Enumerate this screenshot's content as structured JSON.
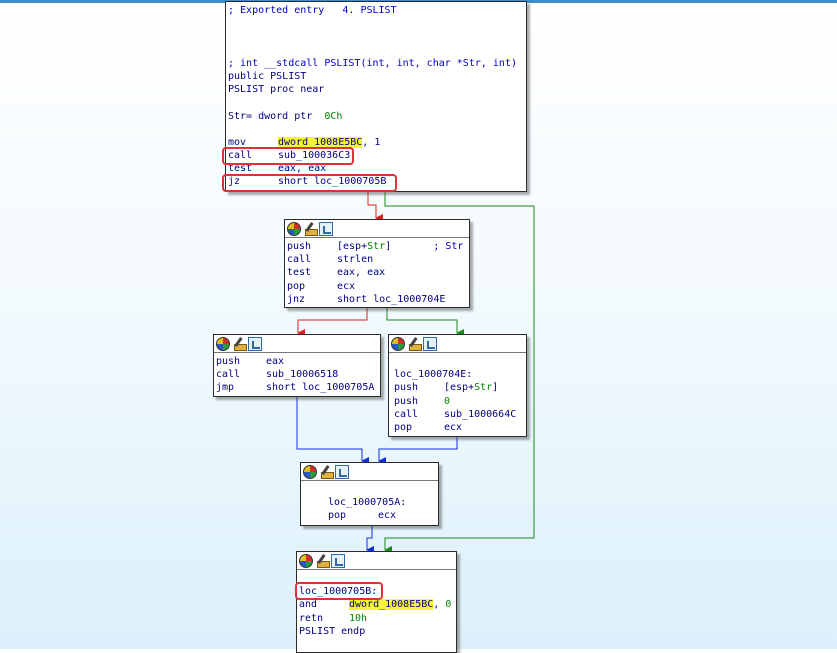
{
  "colors": {
    "edge_true": "#1a8a1a",
    "edge_false": "#e02020",
    "edge_uncond": "#1030e0",
    "highlight": "#f5f534",
    "box": "#e0303a"
  },
  "icons": [
    "color-palette-icon",
    "rename-icon",
    "graph-overview-icon"
  ],
  "node1": {
    "lines": [
      {
        "a": "; Exported entry   4. PSLIST"
      },
      {
        "a": ""
      },
      {
        "a": ""
      },
      {
        "a": ""
      },
      {
        "a": "; int __stdcall PSLIST(int, int, char *Str, int)"
      },
      {
        "a": "public PSLIST"
      },
      {
        "a": "PSLIST proc near"
      },
      {
        "a": ""
      },
      {
        "a": "Str= dword ptr  ",
        "n": "0Ch"
      },
      {
        "a": ""
      },
      {
        "m": "mov",
        "h": "dword_1008E5BC",
        "o": ", 1"
      },
      {
        "m": "call",
        "o": "sub_100036C3"
      },
      {
        "m": "test",
        "o": "eax, eax"
      },
      {
        "m": "jz",
        "o": "short loc_1000705B"
      }
    ]
  },
  "node2": {
    "lines": [
      {
        "m": "push",
        "o": "[esp+",
        "s": "Str",
        "o2": "]",
        "c": "       ; Str"
      },
      {
        "m": "call",
        "o": "strlen"
      },
      {
        "m": "test",
        "o": "eax, eax"
      },
      {
        "m": "pop",
        "o": "ecx"
      },
      {
        "m": "jnz",
        "o": "short loc_1000704E"
      }
    ]
  },
  "node3": {
    "lines": [
      {
        "m": "push",
        "o": "eax"
      },
      {
        "m": "call",
        "o": "sub_10006518"
      },
      {
        "m": "jmp",
        "o": "short loc_1000705A"
      }
    ]
  },
  "node4": {
    "lines": [
      {
        "a": ""
      },
      {
        "a": "loc_1000704E:"
      },
      {
        "m": "push",
        "o": "[esp+",
        "s": "Str",
        "o2": "]"
      },
      {
        "m": "push",
        "n": "0"
      },
      {
        "m": "call",
        "o": "sub_1000664C"
      },
      {
        "m": "pop",
        "o": "ecx"
      }
    ]
  },
  "node5": {
    "lines": [
      {
        "a": ""
      },
      {
        "a": "loc_1000705A:"
      },
      {
        "m": "pop",
        "o": "ecx"
      }
    ]
  },
  "node6": {
    "lines": [
      {
        "a": ""
      },
      {
        "a": "loc_1000705B:"
      },
      {
        "m": "and",
        "h": "dword_1008E5BC",
        "o": ", ",
        "n": "0"
      },
      {
        "m": "retn",
        "n": "10h"
      },
      {
        "a": "PSLIST endp"
      }
    ]
  }
}
